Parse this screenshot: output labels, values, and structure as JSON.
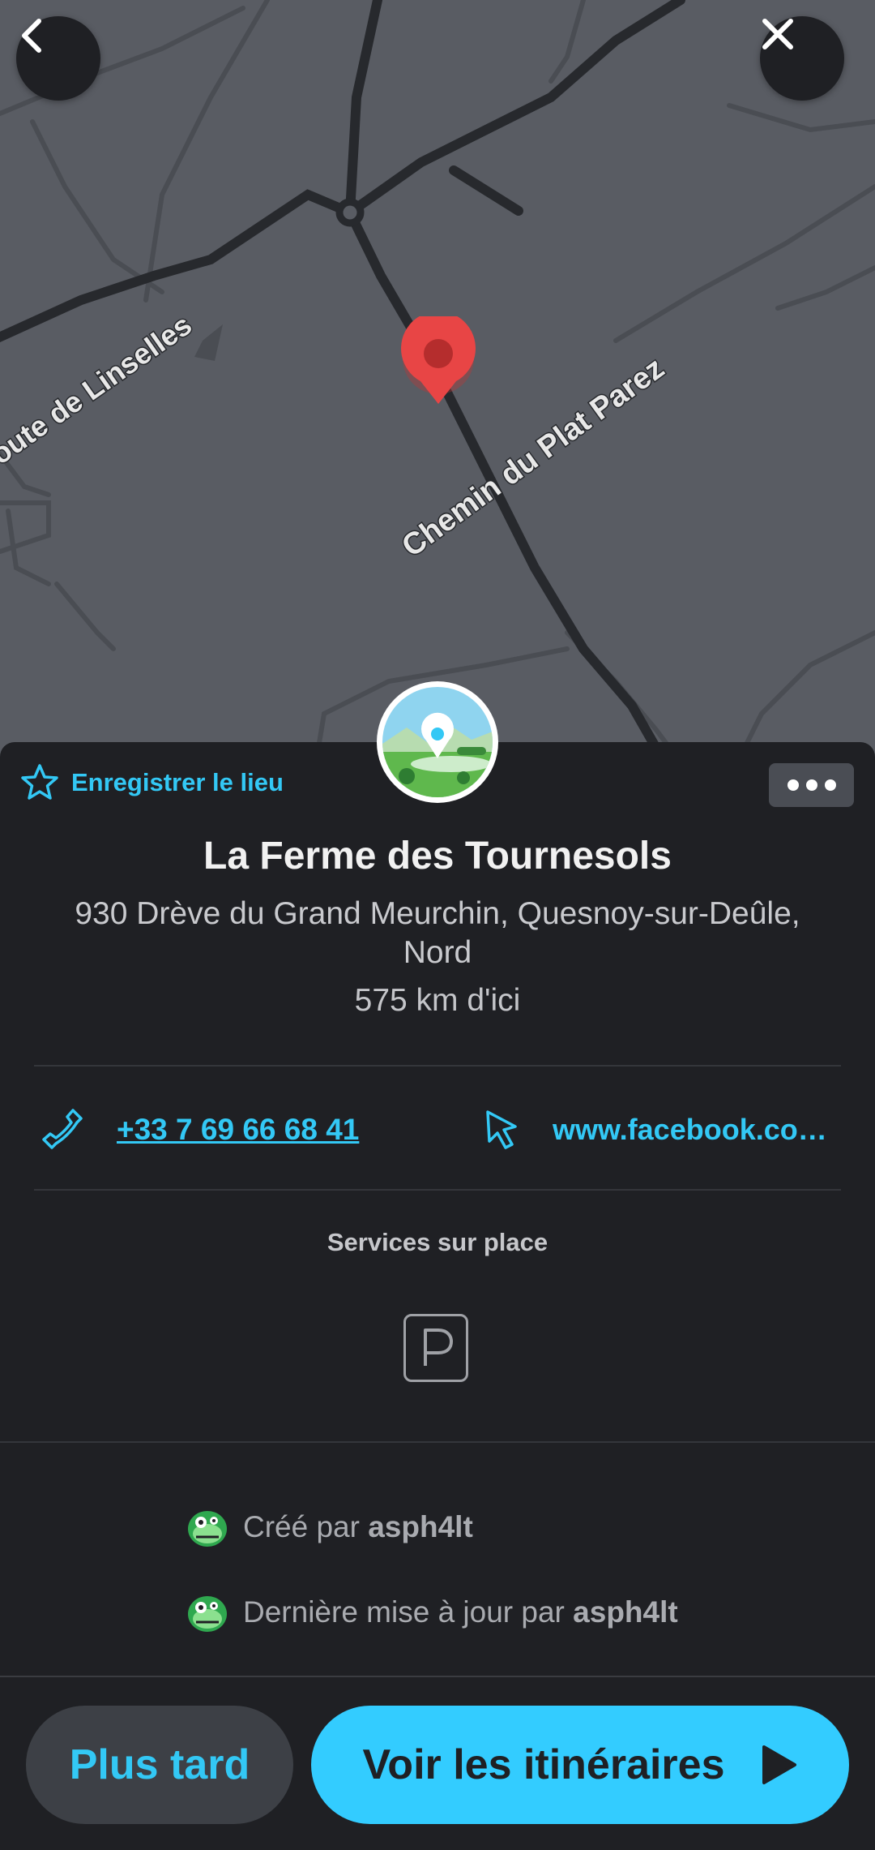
{
  "map": {
    "street_labels": [
      "oute de Linselles",
      "Chemin du Plat Parez"
    ]
  },
  "header": {
    "back_icon": "chevron-left-icon",
    "close_icon": "close-icon"
  },
  "place": {
    "save_label": "Enregistrer le lieu",
    "name": "La Ferme des Tournesols",
    "address": "930 Drève du Grand Meurchin, Quesnoy-sur-Deûle, Nord",
    "distance": "575 km d'ici",
    "phone": "+33 7 69 66 68 41",
    "website": "www.facebook.co…",
    "services_title": "Services sur place",
    "services": [
      "parking-icon"
    ]
  },
  "credits": {
    "created_prefix": "Créé par ",
    "created_user": "asph4lt",
    "updated_prefix": "Dernière mise à jour par ",
    "updated_user": "asph4lt"
  },
  "actions": {
    "later_label": "Plus tard",
    "routes_label": "Voir les itinéraires"
  },
  "colors": {
    "accent": "#33c8f5",
    "background": "#1f2024",
    "map": "#595c63",
    "pin": "#e84545"
  }
}
